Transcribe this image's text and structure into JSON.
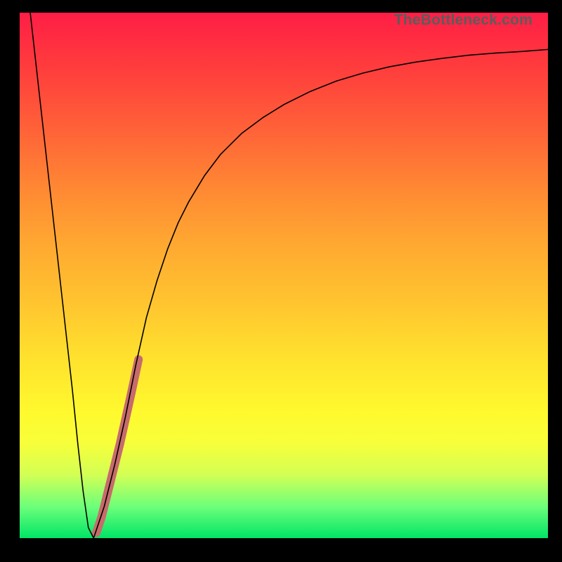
{
  "watermark": "TheBottleneck.com",
  "chart_data": {
    "type": "line",
    "xlabel": "",
    "ylabel": "",
    "xlim": [
      0,
      100
    ],
    "ylim": [
      0,
      100
    ],
    "grid": false,
    "legend": false,
    "series": [
      {
        "name": "curve",
        "color": "#000000",
        "width": 1.6,
        "x": [
          2,
          4,
          6,
          8,
          10,
          11,
          12,
          13,
          14,
          16,
          18,
          20,
          22,
          24,
          26,
          28,
          30,
          32,
          35,
          38,
          42,
          46,
          50,
          55,
          60,
          65,
          70,
          75,
          80,
          85,
          90,
          95,
          100
        ],
        "y": [
          100,
          82,
          64,
          46,
          28,
          18,
          9,
          2,
          0,
          6,
          14,
          23,
          33,
          42,
          49,
          55,
          60,
          64,
          69,
          73,
          77,
          80,
          82.5,
          85,
          87,
          88.5,
          89.7,
          90.6,
          91.3,
          91.9,
          92.3,
          92.6,
          93
        ]
      },
      {
        "name": "highlight-segment",
        "color": "#c76b6b",
        "width": 12,
        "x": [
          14.5,
          15.5,
          17,
          19,
          21,
          22.5
        ],
        "y": [
          1,
          4,
          10,
          18,
          27,
          34
        ]
      }
    ]
  }
}
